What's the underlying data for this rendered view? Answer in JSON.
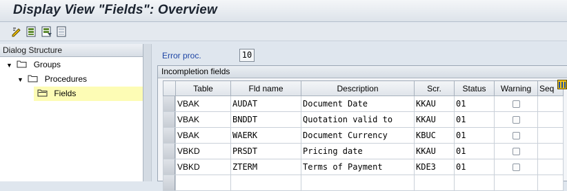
{
  "title": "Display View \"Fields\": Overview",
  "toolbar": {
    "icons": [
      "change-display-icon",
      "select-all-icon",
      "select-block-icon",
      "deselect-all-icon"
    ]
  },
  "dialog_structure": {
    "header": "Dialog Structure",
    "items": [
      {
        "label": "Groups",
        "level": 0,
        "expanded": true
      },
      {
        "label": "Procedures",
        "level": 1,
        "expanded": true
      },
      {
        "label": "Fields",
        "level": 2,
        "selected": true
      }
    ]
  },
  "error_proc": {
    "label": "Error proc.",
    "value": "10"
  },
  "incompletion": {
    "title": "Incompletion fields",
    "columns": [
      "Table",
      "Fld name",
      "Description",
      "Scr.",
      "Status",
      "Warning",
      "Seq"
    ],
    "rows": [
      {
        "table": "VBAK",
        "field": "AUDAT",
        "description": "Document Date",
        "screen": "KKAU",
        "status": "01",
        "warning": false
      },
      {
        "table": "VBAK",
        "field": "BNDDT",
        "description": "Quotation valid to",
        "screen": "KKAU",
        "status": "01",
        "warning": false
      },
      {
        "table": "VBAK",
        "field": "WAERK",
        "description": "Document Currency",
        "screen": "KBUC",
        "status": "01",
        "warning": false
      },
      {
        "table": "VBKD",
        "field": "PRSDT",
        "description": "Pricing date",
        "screen": "KKAU",
        "status": "01",
        "warning": false
      },
      {
        "table": "VBKD",
        "field": "ZTERM",
        "description": "Terms of Payment",
        "screen": "KDE3",
        "status": "01",
        "warning": false
      }
    ]
  }
}
